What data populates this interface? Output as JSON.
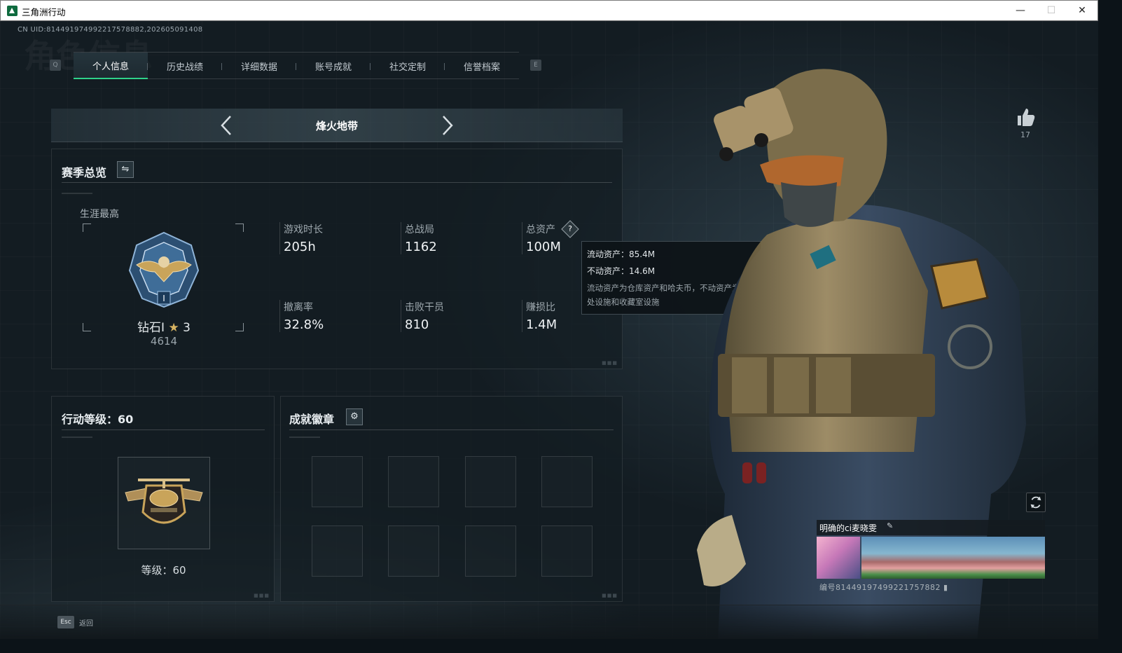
{
  "window": {
    "title": "三角洲行动",
    "minimize": "—",
    "maximize": "☐",
    "close": "✕"
  },
  "uid": "CN UID:814491974992217578882,202605091408",
  "bg_watermark": "角色信息",
  "tabs": {
    "key_left": "Q",
    "key_right": "E",
    "items": [
      {
        "label": "个人信息",
        "active": true
      },
      {
        "label": "历史战绩"
      },
      {
        "label": "详细数据"
      },
      {
        "label": "账号成就"
      },
      {
        "label": "社交定制"
      },
      {
        "label": "信誉档案"
      }
    ]
  },
  "mode": {
    "title": "烽火地带",
    "prev_icon": "chevron-left-icon",
    "next_icon": "chevron-right-icon"
  },
  "season": {
    "title": "赛季总览",
    "swap_icon": "swap-icon",
    "career_label": "生涯最高",
    "rank_name": "钻石I",
    "rank_stars": "3",
    "rank_score": "4614",
    "stats": [
      {
        "label": "游戏时长",
        "value": "205h"
      },
      {
        "label": "总战局",
        "value": "1162"
      },
      {
        "label": "总资产",
        "value": "100M"
      },
      {
        "label": "撤离率",
        "value": "32.8%"
      },
      {
        "label": "击败干员",
        "value": "810"
      },
      {
        "label": "赚损比",
        "value": "1.4M"
      }
    ],
    "help_icon": "?"
  },
  "tooltip": {
    "line1": "流动资产：85.4M",
    "line2": "不动资产：14.6M",
    "desc": "流动资产为仓库资产和哈夫币，不动资产为特勤处设施和收藏室设施"
  },
  "level": {
    "title": "行动等级：60",
    "value": "等级：60"
  },
  "achievements": {
    "title": "成就徽章",
    "gear_icon": "⚙"
  },
  "profile": {
    "likes": "17",
    "name": "明确的ci麦晓雯",
    "edit_icon": "✎",
    "id_text": "编号81449197499221757882"
  },
  "footer": {
    "esc": "Esc",
    "back": "返回"
  },
  "colors": {
    "accent": "#2fd28a",
    "gold": "#c9a45a"
  }
}
